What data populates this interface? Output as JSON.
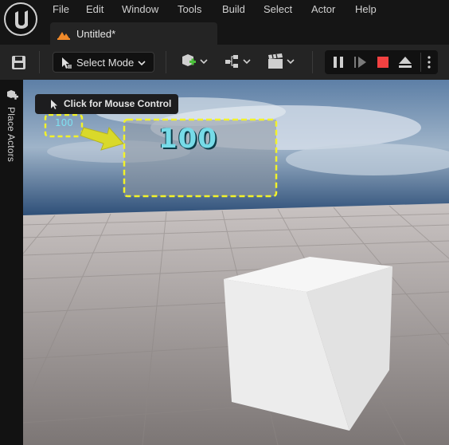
{
  "app": {
    "logo_icon": "unreal-engine-logo-icon",
    "menu": [
      "File",
      "Edit",
      "Window",
      "Tools",
      "Build",
      "Select",
      "Actor",
      "Help"
    ],
    "tab": {
      "title": "Untitled*",
      "icon": "level-map-icon"
    }
  },
  "toolbar": {
    "select_mode_label": "Select Mode",
    "buttons": [
      "save-icon",
      "add-actor-icon",
      "blueprint-icon",
      "cinematics-icon"
    ],
    "play_controls": [
      "pause-icon",
      "step-frame-icon",
      "stop-icon",
      "eject-icon",
      "more-options-icon"
    ]
  },
  "sidebar": {
    "label": "Place Actors"
  },
  "viewport": {
    "mouse_tip": "Click for Mouse Control",
    "score_small": "100",
    "score_large": "100",
    "highlight_color": "#f2f22a"
  }
}
